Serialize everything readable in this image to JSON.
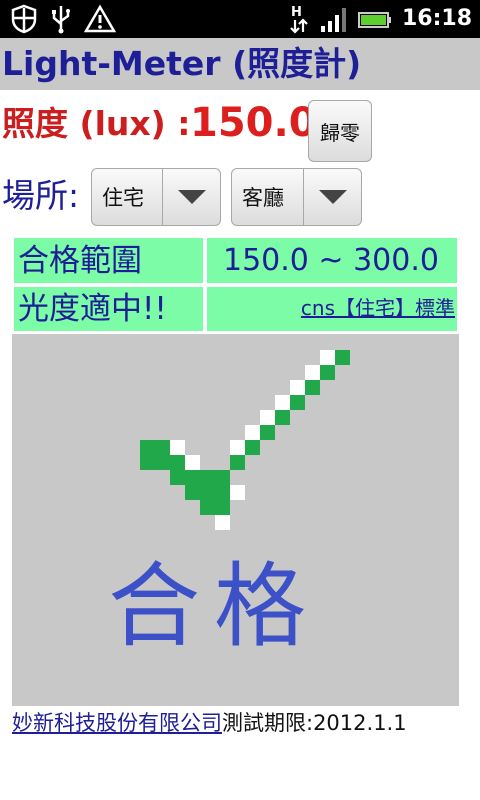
{
  "status_bar": {
    "time": "16:18",
    "icons": [
      "shield-icon",
      "usb-icon",
      "warning-icon",
      "data-transfer-icon",
      "signal-icon",
      "battery-icon"
    ],
    "data_indicator": "H"
  },
  "app": {
    "title": "Light-Meter (照度計)"
  },
  "lux": {
    "label": "照度 (lux) :",
    "value": "150.0",
    "zero_button": "歸零"
  },
  "location": {
    "label": "場所:",
    "building": "住宅",
    "room": "客廳"
  },
  "info": {
    "range_label": "合格範圍",
    "range_value": "150.0 ~ 300.0",
    "status": "光度適中!!",
    "standard_link": "cns【住宅】標準"
  },
  "result": {
    "pass_text": "合格",
    "icon": "checkmark-icon",
    "check_color": "#21a84a"
  },
  "footer": {
    "company": "妙新科技股份有限公司",
    "expiry": "測試期限:2012.1.1"
  },
  "colors": {
    "title": "#1e1e96",
    "lux": "#dd1e1e",
    "table_bg": "#7dfca8",
    "panel_bg": "#c8c8c8",
    "pass_text": "#3c50c8"
  }
}
